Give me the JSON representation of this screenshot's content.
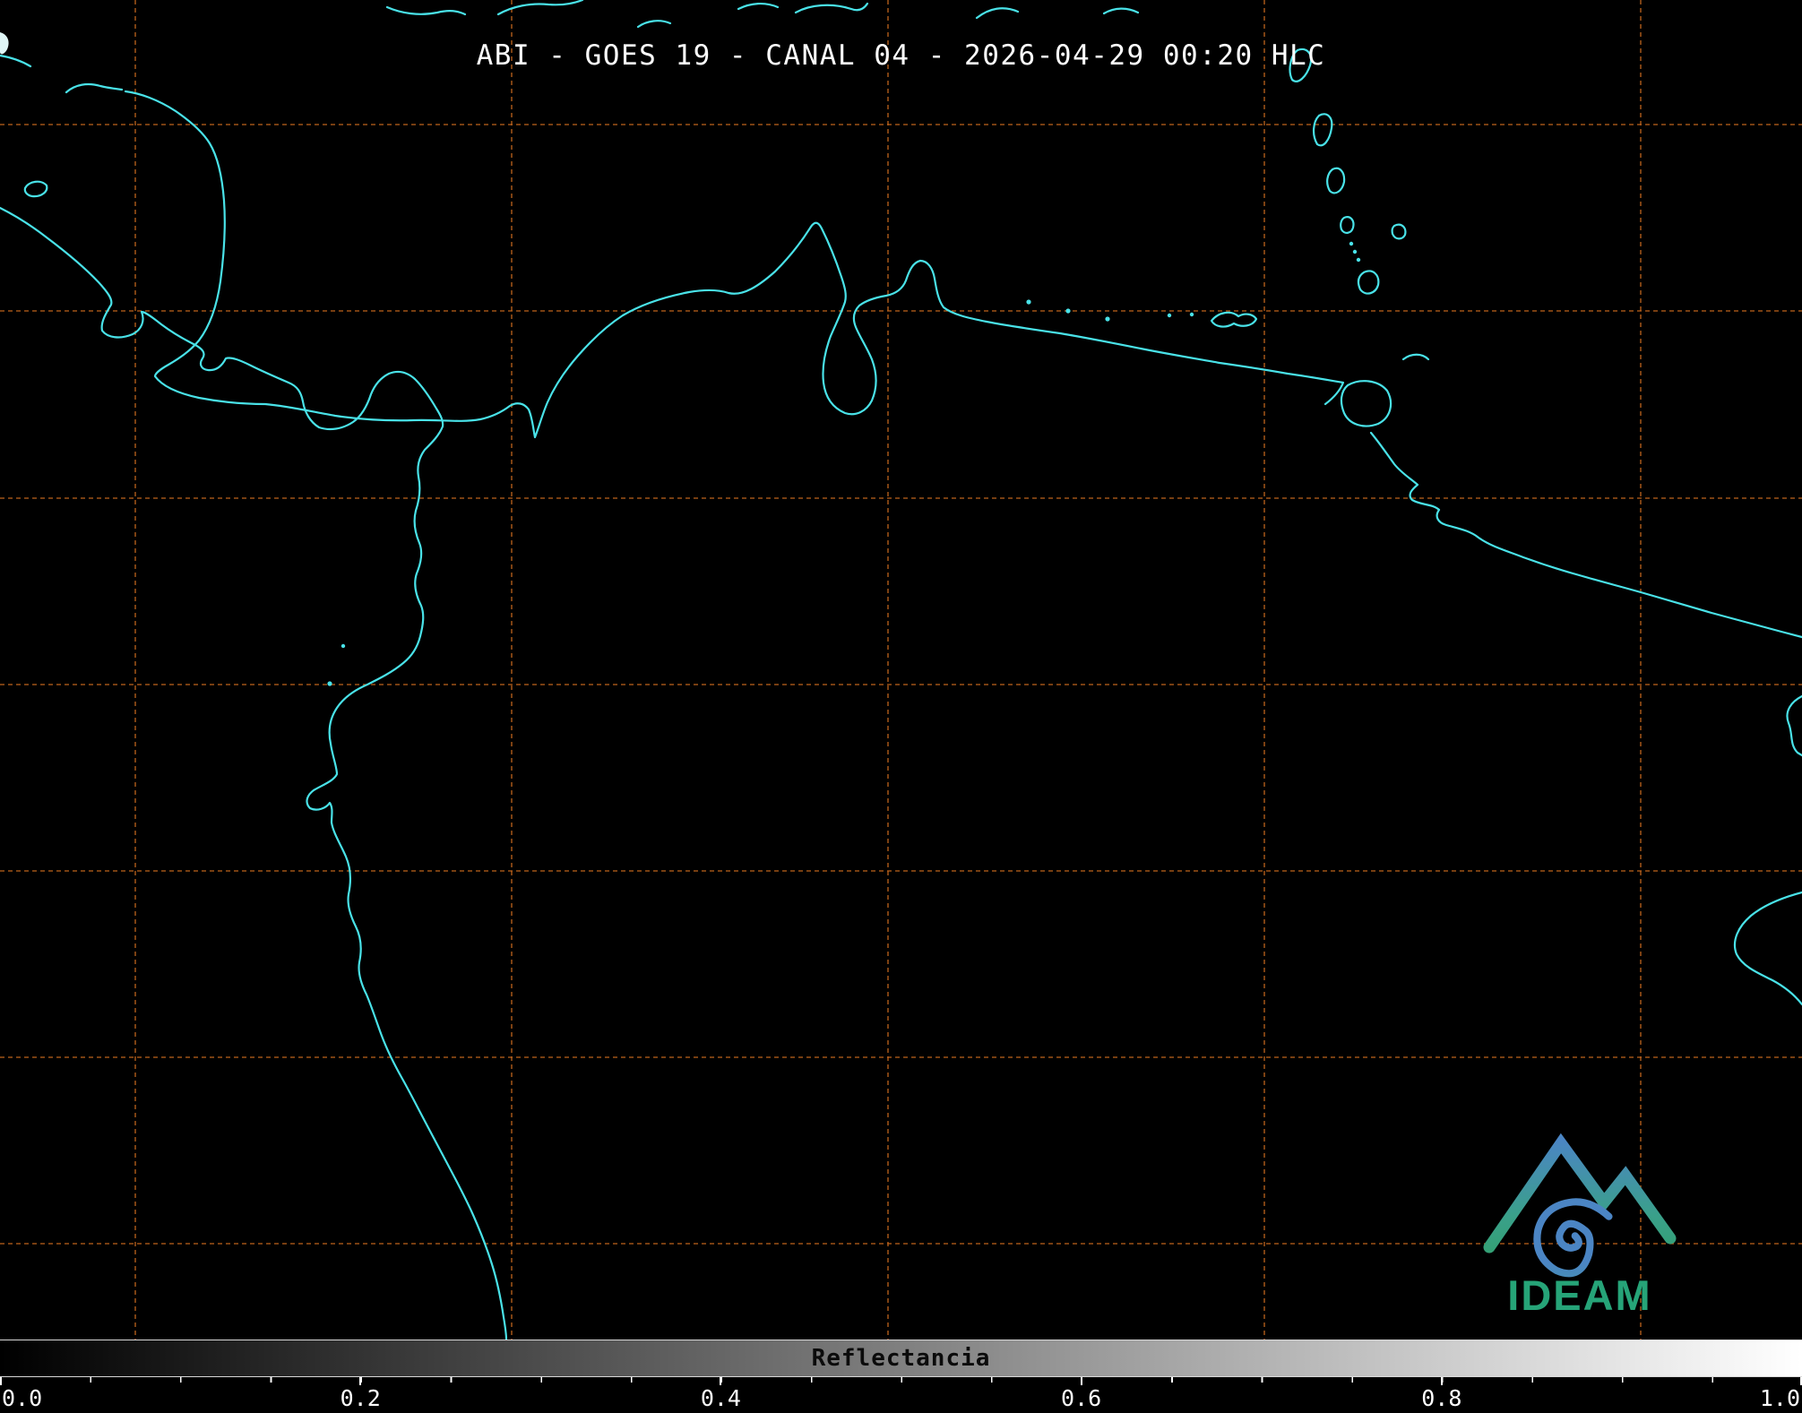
{
  "header": {
    "title": "ABI - GOES 19 - CANAL 04 - 2026-04-29 00:20 HLC"
  },
  "map": {
    "background_color": "#000000",
    "coastline_color": "#49e2e8",
    "grid_color": "#c96a1e",
    "region": "Central America, Caribbean and northwestern South America coastlines"
  },
  "colorbar": {
    "label": "Reflectancia",
    "min": "0.0",
    "max": "1.0",
    "ticks": [
      "0.0",
      "0.2",
      "0.4",
      "0.6",
      "0.8",
      "1.0"
    ],
    "gradient_start": "#000000",
    "gradient_end": "#ffffff"
  },
  "logo": {
    "text": "IDEAM",
    "text_color": "#26a478",
    "gradient_top": "#4b85c4",
    "gradient_bottom": "#2da05e"
  }
}
